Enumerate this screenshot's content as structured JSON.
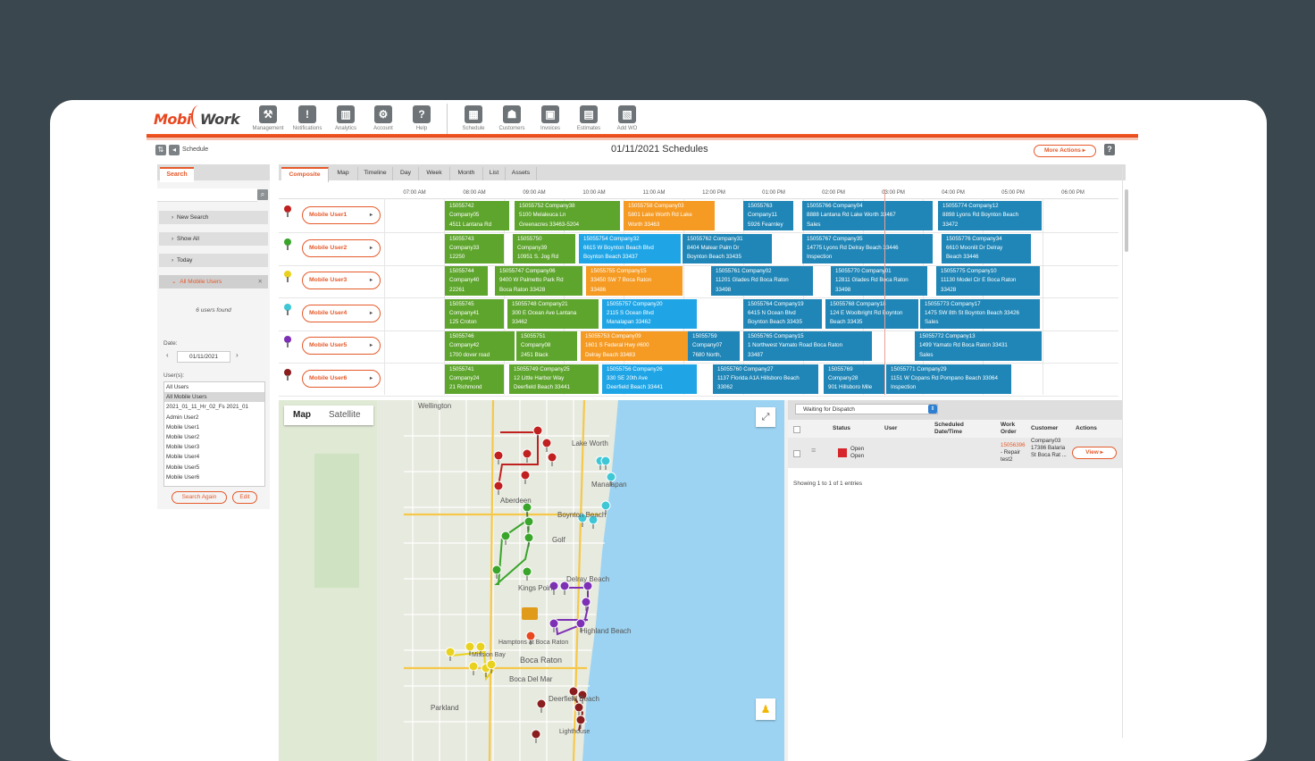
{
  "header": {
    "logo_part1": "Mobi",
    "logo_part2": "Work",
    "nav": [
      {
        "label": "Management",
        "icon": "tools-icon",
        "glyph": "⚒"
      },
      {
        "label": "Notifications",
        "icon": "exclamation-icon",
        "glyph": "!"
      },
      {
        "label": "Analytics",
        "icon": "bar-chart-icon",
        "glyph": "▥"
      },
      {
        "label": "Account",
        "icon": "gears-icon",
        "glyph": "⚙"
      },
      {
        "label": "Help",
        "icon": "question-icon",
        "glyph": "?"
      },
      {
        "label": "Schedule",
        "icon": "calendar-icon",
        "glyph": "▦"
      },
      {
        "label": "Customers",
        "icon": "customer-icon",
        "glyph": "☗"
      },
      {
        "label": "Invoices",
        "icon": "invoice-icon",
        "glyph": "▣"
      },
      {
        "label": "Estimates",
        "icon": "calculator-icon",
        "glyph": "▤"
      },
      {
        "label": "Add WO",
        "icon": "add-work-order-icon",
        "glyph": "▧"
      }
    ]
  },
  "titlebar": {
    "crumb": "Schedule",
    "title": "01/11/2021 Schedules",
    "more_actions": "More Actions",
    "help": "?"
  },
  "left_panel": {
    "tab": "Search",
    "rows": [
      "New Search",
      "Show All",
      "Today",
      "All Mobile Users"
    ],
    "found": "6 users found",
    "date_label": "Date:",
    "date_value": "01/11/2021",
    "users_label": "User(s):",
    "users": [
      "All Users",
      "All Mobile Users",
      "2021_01_11_Hr_02_Fs 2021_01",
      "Admin User2",
      "Mobile User1",
      "Mobile User2",
      "Mobile User3",
      "Mobile User4",
      "Mobile User5",
      "Mobile User6"
    ],
    "search_again": "Search Again",
    "edit": "Edit"
  },
  "schedule": {
    "tabs": [
      "Composite",
      "Map",
      "Timeline",
      "Day",
      "Week",
      "Month",
      "List",
      "Assets"
    ],
    "times": [
      "07:00 AM",
      "08:00 AM",
      "09:00 AM",
      "10:00 AM",
      "11:00 AM",
      "12:00 PM",
      "01:00 PM",
      "02:00 PM",
      "03:00 PM",
      "04:00 PM",
      "05:00 PM",
      "06:00 PM"
    ],
    "rows": [
      {
        "user": "Mobile User1",
        "pin": "#c0201f",
        "jobs": [
          {
            "c": "g",
            "lines": [
              "15055742",
              "Company05",
              "4511 Lantana Rd"
            ]
          },
          {
            "c": "g",
            "lines": [
              "15055752 Company38",
              "5100 Melaleuca Ln",
              "Greenacres 33463-5204"
            ]
          },
          {
            "c": "o",
            "lines": [
              "15055758 Company03",
              "5801 Lake Worth Rd Lake",
              "Worth 33463"
            ]
          },
          {
            "c": "b",
            "lines": [
              "15055763",
              "Company11",
              "5926 Fearnley"
            ]
          },
          {
            "c": "b",
            "lines": [
              "15055766 Company04",
              "8888 Lantana Rd Lake Worth 33467",
              "Sales"
            ]
          },
          {
            "c": "b",
            "lines": [
              "15055774 Company12",
              "8898 Lyons Rd Boynton Beach",
              "33472"
            ]
          }
        ]
      },
      {
        "user": "Mobile User2",
        "pin": "#3aa52b",
        "jobs": [
          {
            "c": "g",
            "lines": [
              "15055743",
              "Company33",
              "12250"
            ]
          },
          {
            "c": "g",
            "lines": [
              "15055750",
              "Company39",
              "10951 S. Jog Rd"
            ]
          },
          {
            "c": "c",
            "lines": [
              "15055754 Company32",
              "6615 W Boynton Beach Blvd",
              "Boynton Beach 33437"
            ]
          },
          {
            "c": "b",
            "lines": [
              "15055762 Company31",
              "8404 Malear Palm Dr",
              "Boynton Beach 33435"
            ]
          },
          {
            "c": "b",
            "lines": [
              "15055767 Company35",
              "14775 Lyons Rd Delray Beach 33446",
              "Inspection"
            ]
          },
          {
            "c": "b",
            "lines": [
              "15055776 Company34",
              "6610 Moonlit Dr Delray",
              "Beach 33446"
            ]
          }
        ]
      },
      {
        "user": "Mobile User3",
        "pin": "#e9d21f",
        "jobs": [
          {
            "c": "g",
            "lines": [
              "15055744",
              "Company40",
              "22261"
            ]
          },
          {
            "c": "g",
            "lines": [
              "15055747 Company06",
              "9400 W Palmetto Park Rd",
              "Boca Raton 33428"
            ]
          },
          {
            "c": "o",
            "lines": [
              "15055755 Company15",
              "33450 SW 7 Boca Raton",
              "33486"
            ]
          },
          {
            "c": "b",
            "lines": [
              "15055761 Company02",
              "11201 Glades Rd Boca Raton",
              "33498"
            ]
          },
          {
            "c": "b",
            "lines": [
              "15055770 Company01",
              "12811 Glades Rd Boca Raton",
              "33498"
            ]
          },
          {
            "c": "b",
            "lines": [
              "15055775 Company10",
              "11130 Model Cir E Boca Raton",
              "33428"
            ]
          }
        ]
      },
      {
        "user": "Mobile User4",
        "pin": "#3fc7d6",
        "jobs": [
          {
            "c": "g",
            "lines": [
              "15055745",
              "Company41",
              "125 Croton"
            ]
          },
          {
            "c": "g",
            "lines": [
              "15055748 Company21",
              "300 E Ocean Ave Lantana",
              "33462"
            ]
          },
          {
            "c": "c",
            "lines": [
              "15055757 Company20",
              "2115 S Ocean Blvd",
              "Manalapan 33462"
            ]
          },
          {
            "c": "b",
            "lines": [
              "15055764 Company19",
              "6415 N Ocean Blvd",
              "Boynton Beach 33435"
            ]
          },
          {
            "c": "b",
            "lines": [
              "15055768 Company18",
              "124 E Woolbright Rd Boynton",
              "Beach 33435"
            ]
          },
          {
            "c": "b",
            "lines": [
              "15055773 Company17",
              "1475 SW 8th St Boynton Beach 33426",
              "Sales"
            ]
          }
        ]
      },
      {
        "user": "Mobile User5",
        "pin": "#7d2fb5",
        "jobs": [
          {
            "c": "g",
            "lines": [
              "15055746",
              "Company42",
              "1700 dover road"
            ]
          },
          {
            "c": "g",
            "lines": [
              "15055751",
              "Company08",
              "2451 Black"
            ]
          },
          {
            "c": "o",
            "lines": [
              "15055753 Company09",
              "1601 S Federal Hwy #600",
              "Delray Beach 33483"
            ]
          },
          {
            "c": "b",
            "lines": [
              "15055759",
              "Company07",
              "7680 North,"
            ]
          },
          {
            "c": "b",
            "lines": [
              "15055765 Company15",
              "1 Northwest Yamato Road Boca Raton",
              "33487"
            ]
          },
          {
            "c": "b",
            "lines": [
              "15055772 Company13",
              "1499 Yamato Rd Boca Raton 33431",
              "Sales"
            ]
          }
        ]
      },
      {
        "user": "Mobile User6",
        "pin": "#8a1d1d",
        "jobs": [
          {
            "c": "g",
            "lines": [
              "15055741",
              "Company24",
              "21 Richmond"
            ]
          },
          {
            "c": "g",
            "lines": [
              "15055749 Company25",
              "12 Little Harbor Way",
              "Deerfield Beach 33441"
            ]
          },
          {
            "c": "c",
            "lines": [
              "15055756 Company26",
              "330 SE 20th Ave",
              "Deerfield Beach 33441"
            ]
          },
          {
            "c": "b",
            "lines": [
              "15055760 Company27",
              "1137 Florida A1A Hillsboro Beach",
              "33062"
            ]
          },
          {
            "c": "b",
            "lines": [
              "15055769",
              "Company28",
              "901 Hillsboro Mile"
            ]
          },
          {
            "c": "b",
            "lines": [
              "15055771 Company29",
              "1151 W Copans Rd Pompano Beach 33064",
              "Inspection"
            ]
          }
        ]
      }
    ]
  },
  "map": {
    "tab_map": "Map",
    "tab_satellite": "Satellite",
    "places": [
      "Wellington",
      "Lake Worth",
      "Manalapan",
      "Boynton Beach",
      "Golf",
      "Delray Beach",
      "Kings Point",
      "Highland Beach",
      "Hamptons at Boca Raton",
      "Boca Raton",
      "Boca Del Mar",
      "Parkland",
      "Deerfield Beach",
      "Aberdeen",
      "Mission Bay",
      "Lighthouse"
    ]
  },
  "dispatch": {
    "filter": "Waiting for Dispatch",
    "headers": [
      "Status",
      "User",
      "Scheduled Date/Time",
      "Work Order",
      "Customer",
      "Actions"
    ],
    "row": {
      "status1": "Open",
      "status2": "Open",
      "wo_link": "15056396",
      "wo_rest": "- Repair test2",
      "customer": "Company03 17386 Balaria St Boca Rat ...",
      "action": "View"
    },
    "footer": "Showing 1 to 1 of 1 entries"
  },
  "colors": {
    "accent": "#e55a2b",
    "green": "#5ea52d",
    "blue": "#1f86b7",
    "cyan": "#1fa5e6",
    "orange": "#f59a22",
    "background": "#3b474f"
  }
}
